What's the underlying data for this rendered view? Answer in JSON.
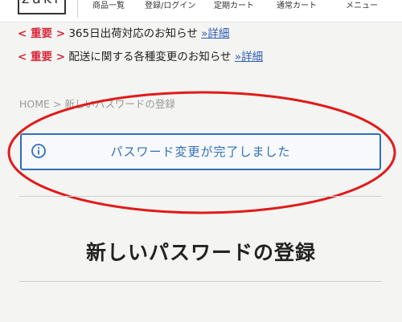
{
  "header": {
    "logo_text": "zuki",
    "nav": [
      {
        "label": "商品一覧"
      },
      {
        "label": "登録/ログイン"
      },
      {
        "label": "定期カート"
      },
      {
        "label": "通常カート"
      },
      {
        "label": "メニュー"
      }
    ]
  },
  "notices": [
    {
      "marker": "< 重要 >",
      "text": "365日出荷対応のお知らせ",
      "link": "»詳細"
    },
    {
      "marker": "< 重要 >",
      "text": "配送に関する各種変更のお知らせ",
      "link": "»詳細"
    }
  ],
  "breadcrumb": {
    "home": "HOME",
    "separator": ">",
    "current": "新しいパスワードの登録"
  },
  "alert": {
    "icon": "info-icon",
    "message": "パスワード変更が完了しました",
    "color": "#2f6fb6"
  },
  "annotation": {
    "shape": "ellipse",
    "color": "#e01b1b"
  },
  "page": {
    "title": "新しいパスワードの登録"
  }
}
